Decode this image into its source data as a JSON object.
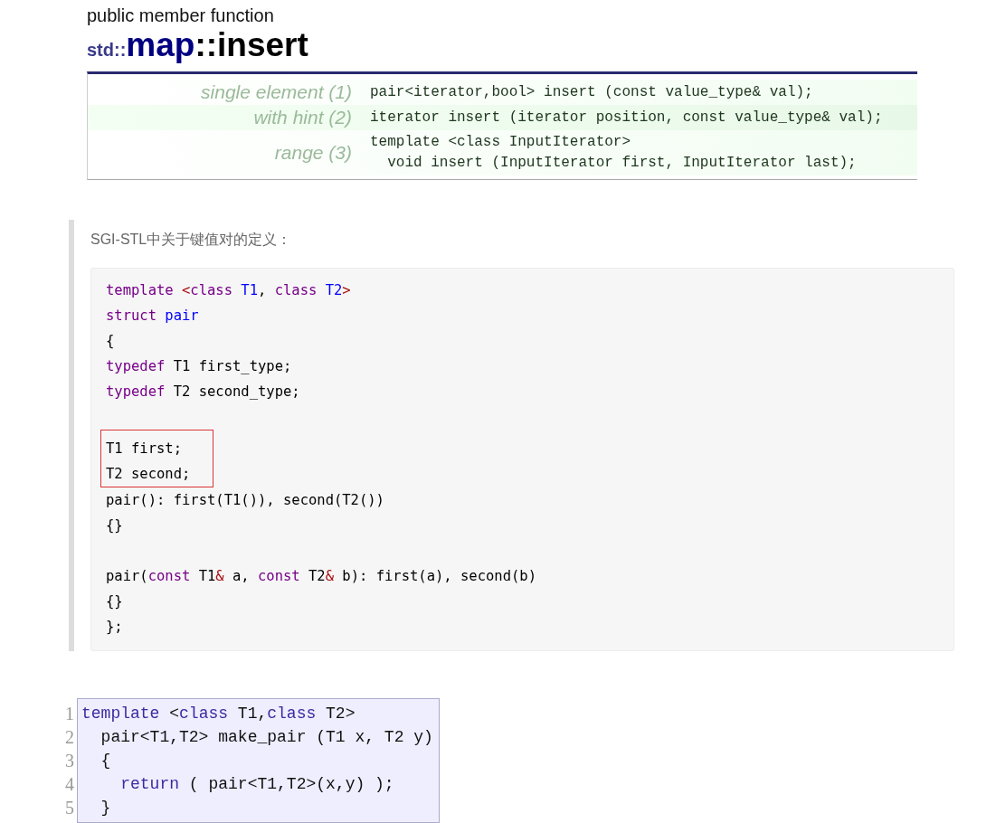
{
  "header": {
    "kind_label": "public member function",
    "namespace": "std::",
    "class_name": "map",
    "member": "::insert"
  },
  "signatures": [
    {
      "label": "single element (1)",
      "lines": [
        "pair<iterator,bool> insert (const value_type& val);"
      ]
    },
    {
      "label": "with hint (2)",
      "lines": [
        "iterator insert (iterator position, const value_type& val);"
      ]
    },
    {
      "label": "range (3)",
      "lines": [
        "template <class InputIterator>",
        "  void insert (InputIterator first, InputIterator last);"
      ]
    }
  ],
  "note": {
    "caption": "SGI-STL中关于键值对的定义：",
    "code": [
      {
        "highlighted": false,
        "tokens": [
          {
            "kind": "keyword",
            "text": "template "
          },
          {
            "kind": "op",
            "text": "<"
          },
          {
            "kind": "keyword",
            "text": "class "
          },
          {
            "kind": "type",
            "text": "T1"
          },
          {
            "kind": "plain",
            "text": ", "
          },
          {
            "kind": "keyword",
            "text": "class "
          },
          {
            "kind": "type",
            "text": "T2"
          },
          {
            "kind": "op",
            "text": ">"
          }
        ]
      },
      {
        "highlighted": false,
        "tokens": [
          {
            "kind": "keyword",
            "text": "struct "
          },
          {
            "kind": "type",
            "text": "pair"
          }
        ]
      },
      {
        "highlighted": false,
        "tokens": [
          {
            "kind": "plain",
            "text": "{"
          }
        ]
      },
      {
        "highlighted": false,
        "tokens": [
          {
            "kind": "keyword",
            "text": "typedef "
          },
          {
            "kind": "plain",
            "text": "T1 first_type;"
          }
        ]
      },
      {
        "highlighted": false,
        "tokens": [
          {
            "kind": "keyword",
            "text": "typedef "
          },
          {
            "kind": "plain",
            "text": "T2 second_type;"
          }
        ]
      },
      {
        "highlighted": false
      },
      {
        "highlighted": true,
        "tokens": [
          {
            "kind": "plain",
            "text": "T1 first;"
          }
        ]
      },
      {
        "highlighted": true,
        "tokens": [
          {
            "kind": "plain",
            "text": "T2 second;"
          }
        ]
      },
      {
        "highlighted": false,
        "tokens": [
          {
            "kind": "plain",
            "text": "pair(): first(T1()), second(T2())"
          }
        ]
      },
      {
        "highlighted": false,
        "tokens": [
          {
            "kind": "plain",
            "text": "{}"
          }
        ]
      },
      {
        "highlighted": false
      },
      {
        "highlighted": false,
        "tokens": [
          {
            "kind": "plain",
            "text": "pair("
          },
          {
            "kind": "keyword",
            "text": "const "
          },
          {
            "kind": "plain",
            "text": "T1"
          },
          {
            "kind": "op",
            "text": "&"
          },
          {
            "kind": "plain",
            "text": " a, "
          },
          {
            "kind": "keyword",
            "text": "const "
          },
          {
            "kind": "plain",
            "text": "T2"
          },
          {
            "kind": "op",
            "text": "&"
          },
          {
            "kind": "plain",
            "text": " b): first(a), second(b)"
          }
        ]
      },
      {
        "highlighted": false,
        "tokens": [
          {
            "kind": "plain",
            "text": "{}"
          }
        ]
      },
      {
        "highlighted": false,
        "tokens": [
          {
            "kind": "plain",
            "text": "};"
          }
        ]
      }
    ]
  },
  "listing": {
    "lines": [
      {
        "number": "1",
        "tokens": [
          {
            "kind": "keyword",
            "text": "template "
          },
          {
            "kind": "plain",
            "text": "<"
          },
          {
            "kind": "keyword",
            "text": "class "
          },
          {
            "kind": "plain",
            "text": "T1,"
          },
          {
            "kind": "keyword",
            "text": "class "
          },
          {
            "kind": "plain",
            "text": "T2>"
          }
        ]
      },
      {
        "number": "2",
        "tokens": [
          {
            "kind": "plain",
            "text": "  pair<T1,T2> make_pair (T1 x, T2 y)"
          }
        ]
      },
      {
        "number": "3",
        "tokens": [
          {
            "kind": "plain",
            "text": "  {"
          }
        ]
      },
      {
        "number": "4",
        "tokens": [
          {
            "kind": "keyword",
            "text": "    return"
          },
          {
            "kind": "plain",
            "text": " ( pair<T1,T2>(x,y) );"
          }
        ]
      },
      {
        "number": "5",
        "tokens": [
          {
            "kind": "plain",
            "text": "  }"
          }
        ]
      }
    ]
  }
}
